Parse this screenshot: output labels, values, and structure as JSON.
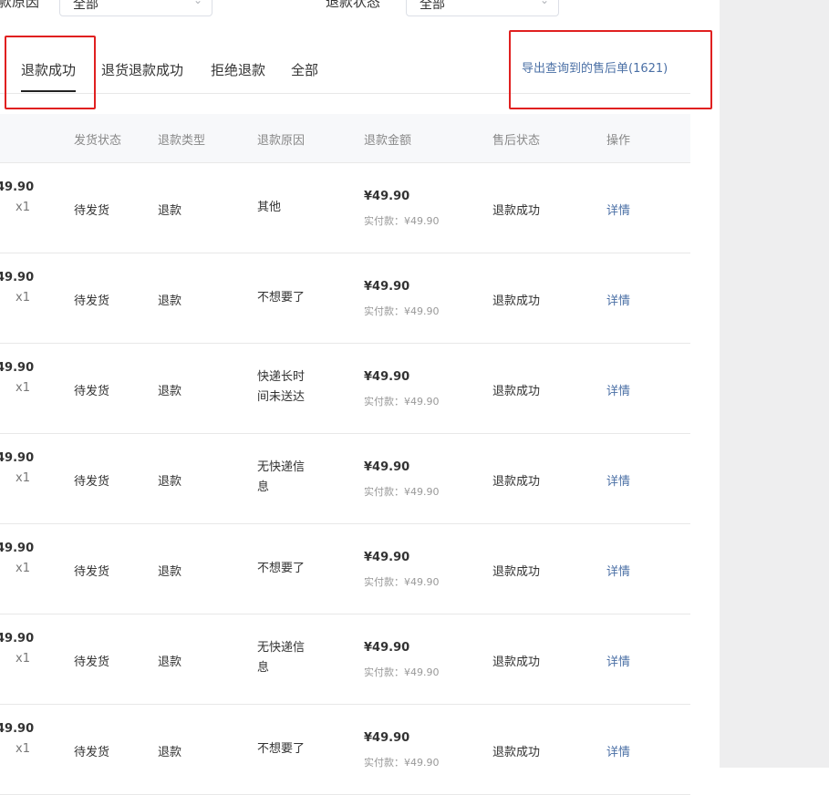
{
  "filters": {
    "reason_label": "款原因",
    "reason_value": "全部",
    "status_label": "退款状态",
    "status_value": "全部"
  },
  "tabs": [
    {
      "label": "退款成功",
      "active": true
    },
    {
      "label": "退货退款成功",
      "active": false
    },
    {
      "label": "拒绝退款",
      "active": false
    },
    {
      "label": "全部",
      "active": false
    }
  ],
  "export_link": "导出查询到的售后单(1621)",
  "table": {
    "headers": [
      "发货状态",
      "退款类型",
      "退款原因",
      "退款金额",
      "售后状态",
      "操作"
    ],
    "rows": [
      {
        "price": "49.90",
        "qty": "x1",
        "ship_status": "待发货",
        "refund_type": "退款",
        "reason": "其他",
        "amount": "¥49.90",
        "paid": "实付款：¥49.90",
        "after_status": "退款成功",
        "action": "详情"
      },
      {
        "price": "49.90",
        "qty": "x1",
        "ship_status": "待发货",
        "refund_type": "退款",
        "reason": "不想要了",
        "amount": "¥49.90",
        "paid": "实付款：¥49.90",
        "after_status": "退款成功",
        "action": "详情"
      },
      {
        "price": "49.90",
        "qty": "x1",
        "ship_status": "待发货",
        "refund_type": "退款",
        "reason": "快递长时间未送达",
        "amount": "¥49.90",
        "paid": "实付款：¥49.90",
        "after_status": "退款成功",
        "action": "详情"
      },
      {
        "price": "49.90",
        "qty": "x1",
        "ship_status": "待发货",
        "refund_type": "退款",
        "reason": "无快递信息",
        "amount": "¥49.90",
        "paid": "实付款：¥49.90",
        "after_status": "退款成功",
        "action": "详情"
      },
      {
        "price": "49.90",
        "qty": "x1",
        "ship_status": "待发货",
        "refund_type": "退款",
        "reason": "不想要了",
        "amount": "¥49.90",
        "paid": "实付款：¥49.90",
        "after_status": "退款成功",
        "action": "详情"
      },
      {
        "price": "49.90",
        "qty": "x1",
        "ship_status": "待发货",
        "refund_type": "退款",
        "reason": "无快递信息",
        "amount": "¥49.90",
        "paid": "实付款：¥49.90",
        "after_status": "退款成功",
        "action": "详情"
      },
      {
        "price": "49.90",
        "qty": "x1",
        "ship_status": "待发货",
        "refund_type": "退款",
        "reason": "不想要了",
        "amount": "¥49.90",
        "paid": "实付款：¥49.90",
        "after_status": "退款成功",
        "action": "详情"
      }
    ]
  },
  "colors": {
    "link": "#4a6fa5",
    "highlight": "#e02020",
    "gutter": "#eeeeef"
  }
}
